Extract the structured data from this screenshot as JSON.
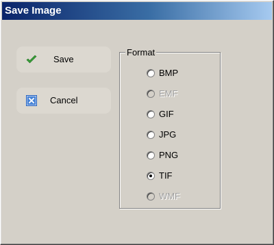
{
  "window": {
    "title": "Save Image"
  },
  "actions": {
    "save_label": "Save",
    "cancel_label": "Cancel"
  },
  "format_group": {
    "title": "Format",
    "options": [
      {
        "label": "BMP",
        "enabled": true,
        "checked": false
      },
      {
        "label": "EMF",
        "enabled": false,
        "checked": false
      },
      {
        "label": "GIF",
        "enabled": true,
        "checked": false
      },
      {
        "label": "JPG",
        "enabled": true,
        "checked": false
      },
      {
        "label": "PNG",
        "enabled": true,
        "checked": false
      },
      {
        "label": "TIF",
        "enabled": true,
        "checked": true
      },
      {
        "label": "WMF",
        "enabled": false,
        "checked": false
      }
    ]
  },
  "icons": {
    "save": "checkmark-icon",
    "cancel": "close-box-icon"
  },
  "colors": {
    "titlebar_start": "#0a246a",
    "titlebar_end": "#a6caf0",
    "save_check": "#3aa03a",
    "cancel_box": "#1f5fbf"
  }
}
